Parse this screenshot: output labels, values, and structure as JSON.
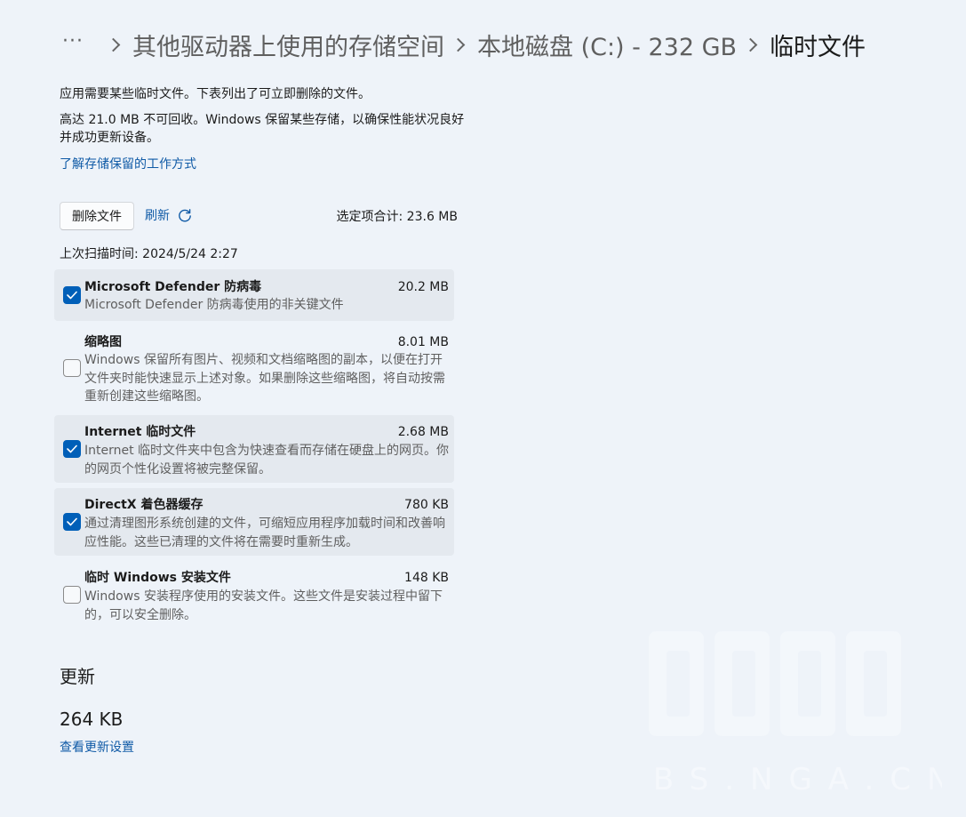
{
  "breadcrumb": {
    "more": "···",
    "items": [
      "其他驱动器上使用的存储空间",
      "本地磁盘 (C:) - 232 GB"
    ],
    "current": "临时文件"
  },
  "intro": {
    "line1": "应用需要某些临时文件。下表列出了可立即删除的文件。",
    "line2": "高达 21.0 MB 不可回收。Windows 保留某些存储，以确保性能状况良好并成功更新设备。",
    "learn_link": "了解存储保留的工作方式"
  },
  "actions": {
    "delete_label": "删除文件",
    "refresh_label": "刷新",
    "selected_total": "选定项合计: 23.6 MB",
    "last_scan": "上次扫描时间: 2024/5/24 2:27"
  },
  "files": [
    {
      "name": "Microsoft Defender 防病毒",
      "size": "20.2 MB",
      "checked": true,
      "desc": "Microsoft Defender 防病毒使用的非关键文件"
    },
    {
      "name": "缩略图",
      "size": "8.01 MB",
      "checked": false,
      "desc": "Windows 保留所有图片、视频和文档缩略图的副本，以便在打开文件夹时能快速显示上述对象。如果删除这些缩略图，将自动按需重新创建这些缩略图。"
    },
    {
      "name": "Internet 临时文件",
      "size": "2.68 MB",
      "checked": true,
      "desc": "Internet 临时文件夹中包含为快速查看而存储在硬盘上的网页。你的网页个性化设置将被完整保留。"
    },
    {
      "name": "DirectX 着色器缓存",
      "size": "780 KB",
      "checked": true,
      "desc": "通过清理图形系统创建的文件，可缩短应用程序加载时间和改善响应性能。这些已清理的文件将在需要时重新生成。"
    },
    {
      "name": "临时 Windows 安装文件",
      "size": "148 KB",
      "checked": false,
      "desc": "Windows 安装程序使用的安装文件。这些文件是安装过程中留下的，可以安全删除。"
    }
  ],
  "updates": {
    "title": "更新",
    "size": "264 KB",
    "link": "查看更新设置"
  },
  "watermark": {
    "text": "BBS.NGA.CN"
  },
  "colors": {
    "background": "#eef3f9",
    "accent": "#005fb8",
    "link": "#0f5aa6",
    "selected_row": "#e4e9ef"
  }
}
